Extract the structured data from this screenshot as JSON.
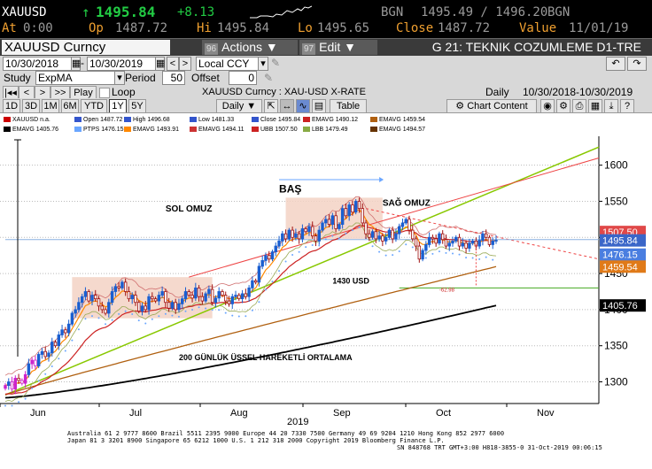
{
  "quote": {
    "symbol": "XAUUSD",
    "arrow": "↑",
    "last": "1495.84",
    "change": "+8.13",
    "bgn_label_1": "BGN",
    "bid_ask": "1495.49 / 1496.20",
    "bgn_label_2": "BGN",
    "at_label": "At",
    "time": "0:00",
    "op_label": "Op",
    "open": "1487.72",
    "hi_label": "Hi",
    "high": "1495.84",
    "lo_label": "Lo",
    "low": "1495.65",
    "close_label": "Close",
    "close": "1487.72",
    "value_label": "Value",
    "value_date": "11/01/19"
  },
  "titlebar": {
    "ticker": "XAUUSD  Curncy",
    "actions_num": "96",
    "actions_label": "Actions ▼",
    "edit_num": "97",
    "edit_label": "Edit ▼",
    "page_name": "G 21: TEKNIK COZUMLEME D1-TRE"
  },
  "controls": {
    "date_from": "10/30/2018",
    "date_to": "10/30/2019",
    "currency": "Local CCY",
    "study_label": "Study",
    "study_value": "ExpMA",
    "period_label": "Period",
    "period_value": "50",
    "offset_label": "Offset",
    "offset_value": "0",
    "play_label": "Play",
    "loop_label": "Loop",
    "security_desc": "XAUUSD  Curncy : XAU-USD X-RATE",
    "frequency_label": "Daily",
    "range_label": "10/30/2018-10/30/2019",
    "table_label": "Table",
    "chart_content_label": "Chart Content",
    "periods": [
      "1D",
      "3D",
      "1M",
      "6M",
      "YTD",
      "1Y",
      "5Y"
    ],
    "selected_period": "1Y",
    "daily_dropdown": "Daily ▼"
  },
  "legend": [
    {
      "name": "XAUUSD",
      "value": "n.a.",
      "color": "#cc0000"
    },
    {
      "name": "Open",
      "value": "1487.72",
      "color": "#3355cc"
    },
    {
      "name": "High",
      "value": "1496.68",
      "color": "#3355cc"
    },
    {
      "name": "Low",
      "value": "1481.33",
      "color": "#3355cc"
    },
    {
      "name": "Close",
      "value": "1495.84",
      "color": "#3355cc"
    },
    {
      "name": "EMAVG",
      "value": "1490.12",
      "color": "#cc2222"
    },
    {
      "name": "EMAVG",
      "value": "1459.54",
      "color": "#b06010"
    },
    {
      "name": "EMAVG",
      "value": "1405.76",
      "color": "#000000"
    },
    {
      "name": "PTPS",
      "value": "1476.15",
      "color": "#6aa6ff"
    },
    {
      "name": "EMAVG",
      "value": "1493.91",
      "color": "#ff8800"
    },
    {
      "name": "EMAVG",
      "value": "1494.11",
      "color": "#cc3333"
    },
    {
      "name": "UBB",
      "value": "1507.50",
      "color": "#cc2222"
    },
    {
      "name": "LBB",
      "value": "1479.49",
      "color": "#88aa44"
    },
    {
      "name": "EMAVG",
      "value": "1494.57",
      "color": "#663300"
    }
  ],
  "chart_data": {
    "type": "candlestick",
    "title": "",
    "xlabel": "2019",
    "ylim": [
      1270,
      1640
    ],
    "y_ticks": [
      1300,
      1350,
      1400,
      1450,
      1500,
      1550,
      1600
    ],
    "x_ticks": [
      "Jun",
      "Jul",
      "Aug",
      "Sep",
      "Oct",
      "Nov"
    ],
    "x_year": "2019",
    "last_price_tags": [
      {
        "value": "1507.50",
        "color": "#dd3333"
      },
      {
        "value": "1495.84",
        "color": "#3366cc"
      },
      {
        "value": "1476.15",
        "color": "#4477dd"
      },
      {
        "value": "1459.54",
        "color": "#cc6600"
      },
      {
        "value": "1405.76",
        "color": "#000000"
      }
    ],
    "candles_close": [
      1295,
      1300,
      1290,
      1305,
      1302,
      1298,
      1310,
      1325,
      1330,
      1322,
      1338,
      1342,
      1335,
      1340,
      1355,
      1350,
      1365,
      1372,
      1368,
      1380,
      1395,
      1400,
      1410,
      1418,
      1425,
      1412,
      1420,
      1415,
      1405,
      1400,
      1395,
      1410,
      1425,
      1432,
      1430,
      1438,
      1425,
      1415,
      1420,
      1410,
      1398,
      1405,
      1400,
      1418,
      1415,
      1412,
      1420,
      1425,
      1410,
      1402,
      1410,
      1400,
      1408,
      1415,
      1425,
      1420,
      1416,
      1430,
      1418,
      1412,
      1422,
      1428,
      1410,
      1416,
      1425,
      1420,
      1412,
      1408,
      1418,
      1420,
      1415,
      1422,
      1418,
      1430,
      1440,
      1438,
      1460,
      1468,
      1475,
      1470,
      1480,
      1488,
      1495,
      1505,
      1498,
      1510,
      1500,
      1505,
      1498,
      1512,
      1508,
      1515,
      1502,
      1495,
      1510,
      1520,
      1525,
      1518,
      1530,
      1512,
      1518,
      1540,
      1530,
      1545,
      1535,
      1550,
      1540,
      1520,
      1505,
      1500,
      1508,
      1498,
      1502,
      1495,
      1500,
      1510,
      1498,
      1505,
      1515,
      1520,
      1525,
      1510,
      1498,
      1488,
      1470,
      1482,
      1490,
      1500,
      1498,
      1492,
      1505,
      1497,
      1488,
      1492,
      1495,
      1500,
      1488,
      1492,
      1485,
      1492,
      1495,
      1488,
      1496,
      1505,
      1500,
      1490,
      1495,
      1496
    ],
    "annotations": [
      {
        "text": "SOL OMUZ"
      },
      {
        "text": "BAŞ"
      },
      {
        "text": "SAĞ OMUZ"
      },
      {
        "text": "1430 USD"
      },
      {
        "text": "200 GÜNLÜK ÜSSEL HAREKETLİ ORTALAMA"
      },
      {
        "text": "-62.98"
      }
    ],
    "series": [
      {
        "name": "EMAVG",
        "value": 1490.12,
        "color": "#cc2222"
      },
      {
        "name": "EMAVG",
        "value": 1459.54,
        "color": "#b06010"
      },
      {
        "name": "EMAVG",
        "value": 1405.76,
        "color": "#000000"
      },
      {
        "name": "PTPS",
        "value": 1476.15,
        "color": "#6aa6ff"
      },
      {
        "name": "UBB",
        "value": 1507.5,
        "color": "#cc2222"
      },
      {
        "name": "LBB",
        "value": 1479.49,
        "color": "#88aa44"
      }
    ],
    "support_level": 1430,
    "grid": "horizontal dotted"
  },
  "footer": {
    "line1": "Australia 61 2 9777 8600 Brazil 5511 2395 9000 Europe 44 20 7330 7500 Germany 49 69 9204 1210 Hong Kong 852 2977 6000",
    "line2": "Japan 81 3 3201 8900         Singapore 65 6212 1000        U.S. 1 212 318 2000            Copyright 2019 Bloomberg Finance L.P.",
    "line3": "SN 848768 TRT  GMT+3:00 H818-3855-0 31-Oct-2019 00:06:15"
  }
}
